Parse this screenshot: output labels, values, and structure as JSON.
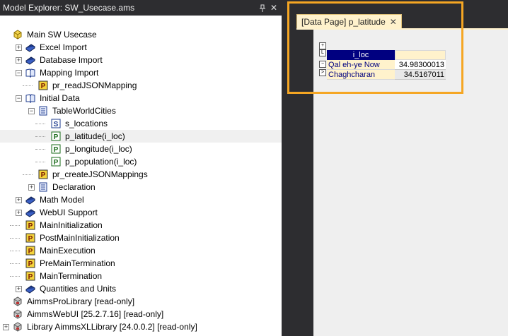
{
  "explorer": {
    "title": "Model Explorer: SW_Usecase.ams",
    "pin_icon": "pin-icon",
    "close_glyph": "✕",
    "tree": [
      {
        "label": "Main SW Usecase",
        "icon": "model-icon",
        "level": 0,
        "expander": null
      },
      {
        "label": "Excel Import",
        "icon": "book-icon",
        "level": 1,
        "expander": "+"
      },
      {
        "label": "Database Import",
        "icon": "book-icon",
        "level": 1,
        "expander": "+"
      },
      {
        "label": "Mapping Import",
        "icon": "open-book-icon",
        "level": 1,
        "expander": "−"
      },
      {
        "label": "pr_readJSONMapping",
        "icon": "procedure-icon",
        "level": 2,
        "expander": null
      },
      {
        "label": "Initial Data",
        "icon": "open-book-icon",
        "level": 1,
        "expander": "−"
      },
      {
        "label": "TableWorldCities",
        "icon": "declaration-icon",
        "level": 2,
        "expander": "−"
      },
      {
        "label": "s_locations",
        "icon": "set-icon",
        "level": 3,
        "expander": null
      },
      {
        "label": "p_latitude(i_loc)",
        "icon": "parameter-icon",
        "level": 3,
        "expander": null,
        "selected": true
      },
      {
        "label": "p_longitude(i_loc)",
        "icon": "parameter-icon",
        "level": 3,
        "expander": null
      },
      {
        "label": "p_population(i_loc)",
        "icon": "parameter-icon",
        "level": 3,
        "expander": null
      },
      {
        "label": "pr_createJSONMappings",
        "icon": "procedure-icon",
        "level": 2,
        "expander": null
      },
      {
        "label": "Declaration",
        "icon": "declaration-icon",
        "level": 2,
        "expander": "+"
      },
      {
        "label": "Math Model",
        "icon": "book-icon",
        "level": 1,
        "expander": "+"
      },
      {
        "label": "WebUI Support",
        "icon": "book-icon",
        "level": 1,
        "expander": "+"
      },
      {
        "label": "MainInitialization",
        "icon": "procedure-icon",
        "level": 1,
        "expander": null
      },
      {
        "label": "PostMainInitialization",
        "icon": "procedure-icon",
        "level": 1,
        "expander": null
      },
      {
        "label": "MainExecution",
        "icon": "procedure-icon",
        "level": 1,
        "expander": null
      },
      {
        "label": "PreMainTermination",
        "icon": "procedure-icon",
        "level": 1,
        "expander": null
      },
      {
        "label": "MainTermination",
        "icon": "procedure-icon",
        "level": 1,
        "expander": null
      },
      {
        "label": "Quantities and Units",
        "icon": "book-icon",
        "level": 1,
        "expander": "+"
      },
      {
        "label": "AimmsProLibrary [read-only]",
        "icon": "library-icon",
        "level": 0,
        "expander": null
      },
      {
        "label": "AimmsWebUI [25.2.7.16] [read-only]",
        "icon": "library-icon",
        "level": 0,
        "expander": null
      },
      {
        "label": "Library AimmsXLLibrary [24.0.0.2] [read-only]",
        "icon": "library-icon",
        "level": 0,
        "expander": "+"
      }
    ]
  },
  "tab": {
    "label": "[Data Page] p_latitude",
    "close_glyph": "✕"
  },
  "data_page": {
    "buttons": [
      "+",
      "L",
      "−",
      ">"
    ],
    "header": {
      "index": "i_loc",
      "value": ""
    },
    "rows": [
      {
        "name": "Qal eh-ye Now",
        "value": "34.98300013"
      },
      {
        "name": "Chaghcharan",
        "value": "34.5167011"
      }
    ]
  },
  "colors": {
    "highlight": "#f5a623",
    "tab": "#fff2cc",
    "header_blue": "#000080"
  }
}
